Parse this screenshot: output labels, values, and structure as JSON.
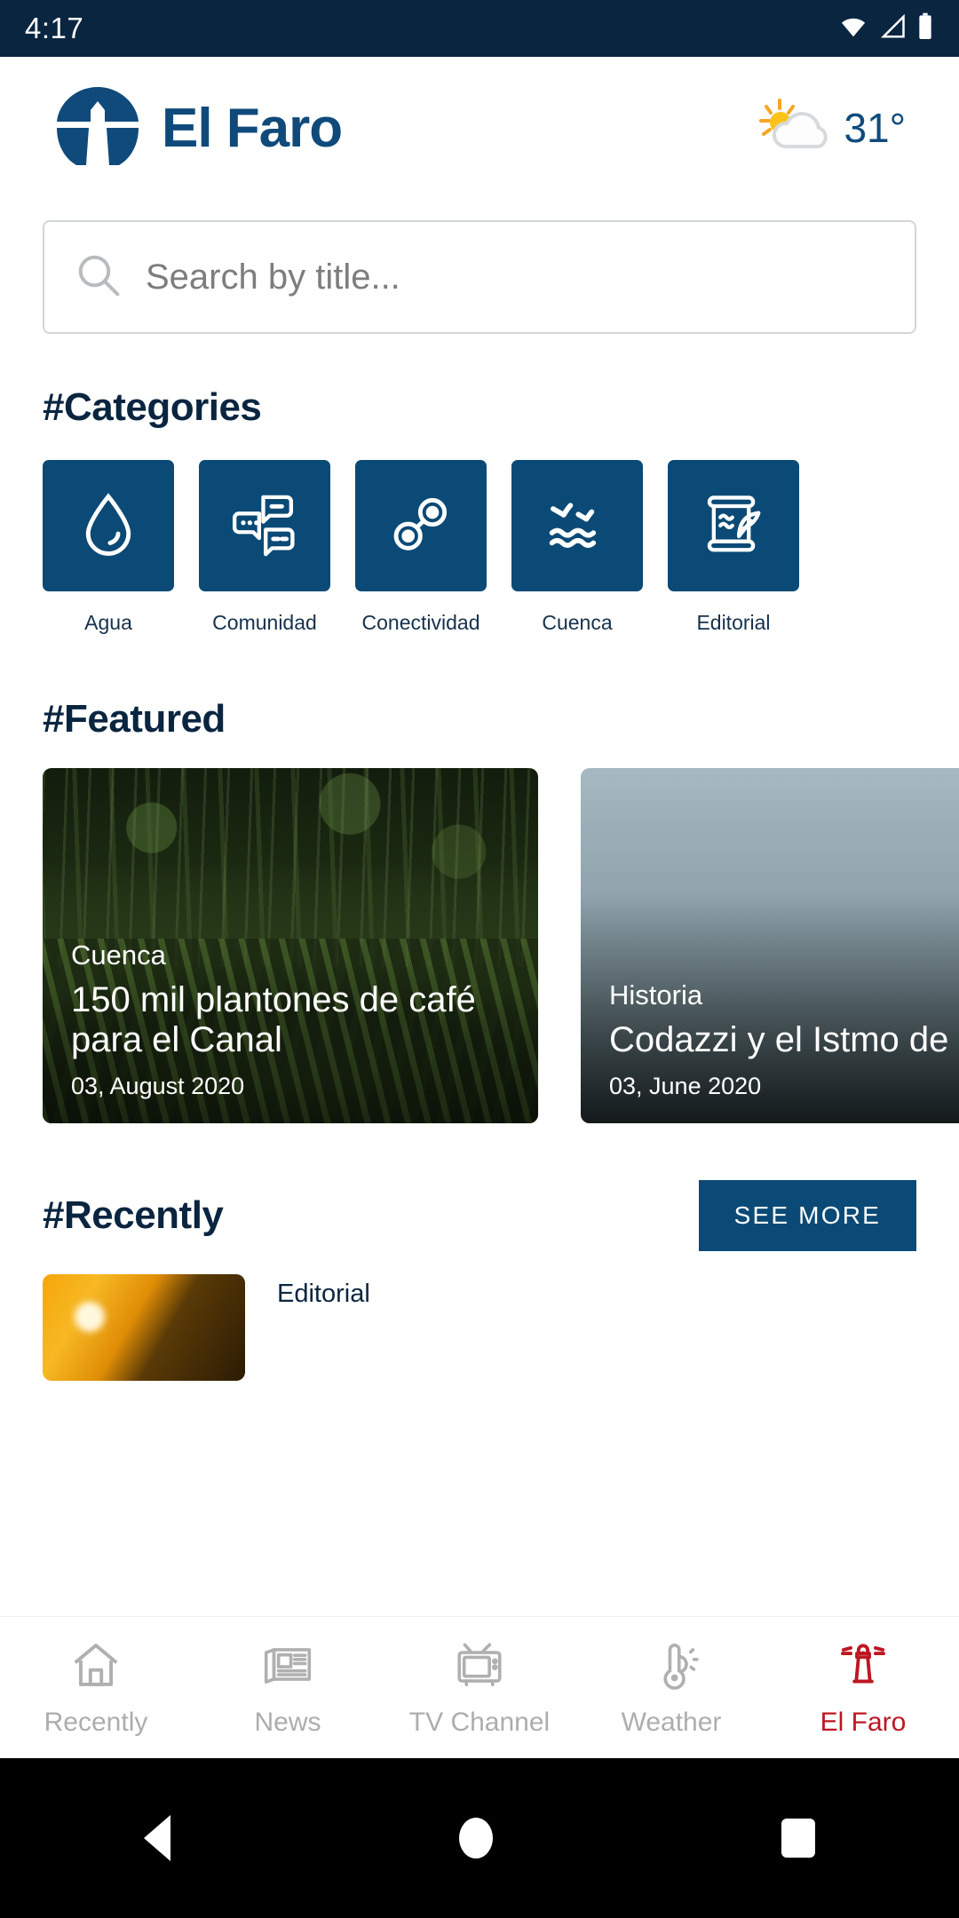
{
  "status_bar": {
    "time": "4:17",
    "icons": [
      "wifi-icon",
      "cellular-signal-icon",
      "battery-icon"
    ]
  },
  "header": {
    "logo_icon": "lighthouse-logo-icon",
    "brand_name": "El Faro",
    "weather": {
      "icon": "sun-behind-cloud-icon",
      "temperature": "31°"
    }
  },
  "search": {
    "icon": "search-icon",
    "placeholder": "Search by title...",
    "value": ""
  },
  "categories": {
    "title": "#Categories",
    "items": [
      {
        "label": "Agua",
        "icon": "water-drop-icon"
      },
      {
        "label": "Comunidad",
        "icon": "chat-bubbles-icon"
      },
      {
        "label": "Conectividad",
        "icon": "network-nodes-icon"
      },
      {
        "label": "Cuenca",
        "icon": "birds-over-waves-icon"
      },
      {
        "label": "Editorial",
        "icon": "scroll-quill-icon"
      }
    ]
  },
  "featured": {
    "title": "#Featured",
    "cards": [
      {
        "category": "Cuenca",
        "title": "150 mil plantones de café para el Canal",
        "date": "03, August 2020",
        "image": "coffee-plantation-forest-photo"
      },
      {
        "category": "Historia",
        "title": "Codazzi y el Istmo de Panamá",
        "title_visible": "Codazz\nIstmo d",
        "date": "03, June 2020",
        "date_visible": "03, June 2",
        "image": "overcast-sky-photo"
      }
    ]
  },
  "recently": {
    "title": "#Recently",
    "see_more_label": "SEE MORE",
    "items": [
      {
        "category": "Editorial",
        "title": "",
        "image": "golden-sunset-photo"
      }
    ]
  },
  "tabbar": {
    "items": [
      {
        "label": "Recently",
        "icon": "home-icon",
        "active": false
      },
      {
        "label": "News",
        "icon": "newspaper-icon",
        "active": false
      },
      {
        "label": "TV Channel",
        "icon": "television-icon",
        "active": false
      },
      {
        "label": "Weather",
        "icon": "thermometer-icon",
        "active": false
      },
      {
        "label": "El Faro",
        "icon": "lighthouse-icon",
        "active": true
      }
    ]
  },
  "android_nav": {
    "back": "back-button",
    "home": "home-button",
    "recents": "recents-button"
  },
  "colors": {
    "status_bar": "#0a2540",
    "brand_blue": "#0f4a7b",
    "tile_blue": "#0b4a76",
    "accent_red": "#be1622",
    "heading": "#0a2540",
    "muted": "#adadad"
  }
}
